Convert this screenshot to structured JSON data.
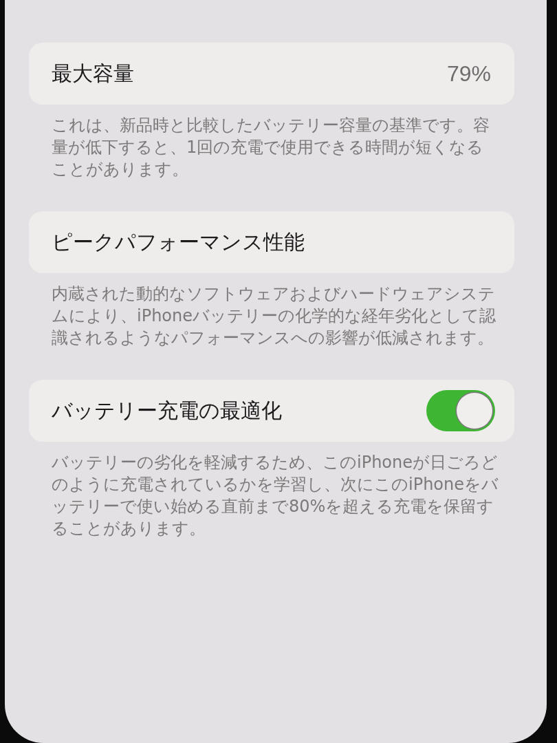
{
  "sections": [
    {
      "kind": "value",
      "title": "最大容量",
      "value": "79%",
      "footer": "これは、新品時と比較したバッテリー容量の基準です。容量が低下すると、1回の充電で使用できる時間が短くなることがあります。"
    },
    {
      "kind": "plain",
      "title": "ピークパフォーマンス性能",
      "footer": "内蔵された動的なソフトウェアおよびハードウェアシステムにより、iPhoneバッテリーの化学的な経年劣化として認識されるようなパフォーマンスへの影響が低減されます。"
    },
    {
      "kind": "toggle",
      "title": "バッテリー充電の最適化",
      "toggle": {
        "on": true
      },
      "footer": "バッテリーの劣化を軽減するため、このiPhoneが日ごろどのように充電されているかを学習し、次にこのiPhoneをバッテリーで使い始める直前まで80%を超える充電を保留することがあります。"
    }
  ]
}
